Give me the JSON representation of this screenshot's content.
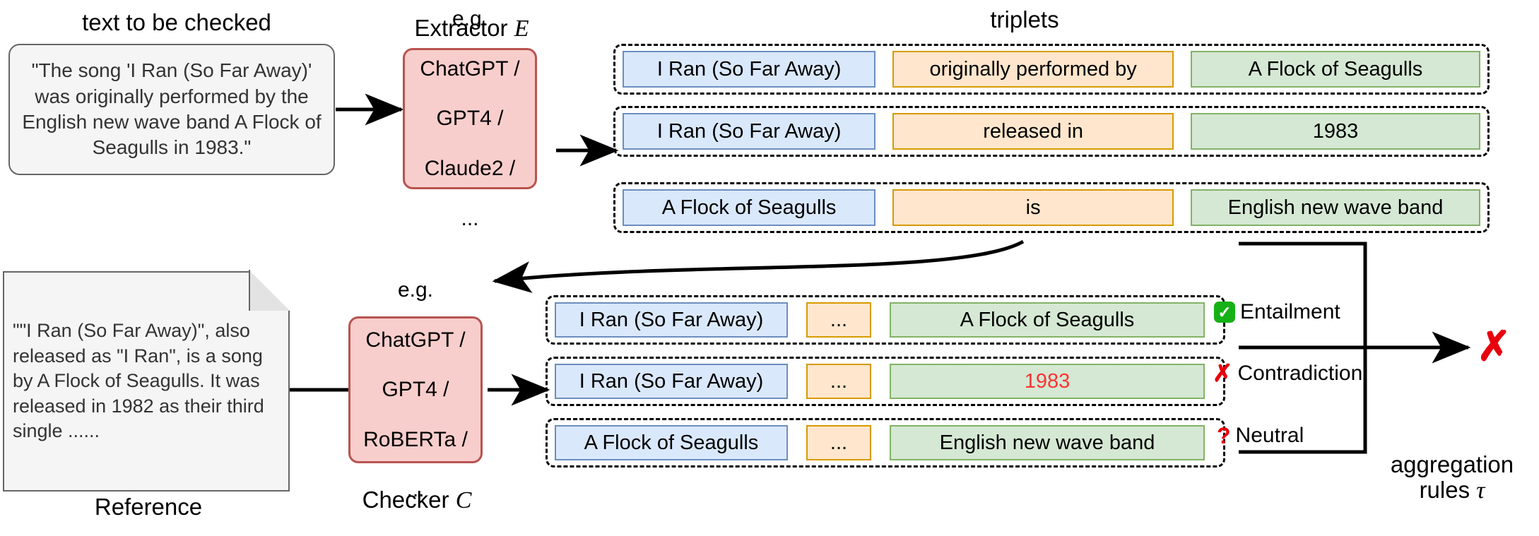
{
  "labels": {
    "text_to_be_checked": "text to be checked",
    "extractor": "Extractor",
    "extractor_symbol": "E",
    "triplets": "triplets",
    "reference": "Reference",
    "checker": "Checker",
    "checker_symbol": "C",
    "aggregation_line1": "aggregation",
    "aggregation_line2": "rules",
    "aggregation_symbol": "τ"
  },
  "input_text": "\"The song 'I Ran (So Far Away)' was originally performed by the English new wave band A Flock of Seagulls in 1983.\"",
  "reference_text": "\"\"I Ran (So Far Away)\", also released as \"I Ran\", is a song by A Flock of Seagulls. It was released in 1982 as their third single ......",
  "extractor_models": [
    "e.g.",
    "ChatGPT /",
    "GPT4 /",
    "Claude2 /",
    "..."
  ],
  "checker_models": [
    "e.g.",
    "ChatGPT /",
    "GPT4 /",
    "RoBERTa /",
    "..."
  ],
  "triplets_extracted": [
    {
      "subject": "I Ran (So Far Away)",
      "relation": "originally performed by",
      "object": "A Flock of Seagulls"
    },
    {
      "subject": "I Ran (So Far Away)",
      "relation": "released in",
      "object": "1983"
    },
    {
      "subject": "A Flock of Seagulls",
      "relation": "is",
      "object": "English new wave band"
    }
  ],
  "triplets_checked": [
    {
      "subject": "I Ran (So Far Away)",
      "relation": "...",
      "object": "A Flock of Seagulls",
      "object_highlighted": false,
      "verdict": "Entailment",
      "verdict_icon": "check-badge-icon"
    },
    {
      "subject": "I Ran (So Far Away)",
      "relation": "...",
      "object": "1983",
      "object_highlighted": true,
      "verdict": "Contradiction",
      "verdict_icon": "cross-mark-icon"
    },
    {
      "subject": "A Flock of Seagulls",
      "relation": "...",
      "object": "English new wave band",
      "object_highlighted": false,
      "verdict": "Neutral",
      "verdict_icon": "question-mark-icon"
    }
  ],
  "final_verdict_icon": "red-cross-icon",
  "colors": {
    "subject_fill": "#dae8fc",
    "subject_border": "#6c8ebf",
    "relation_fill": "#ffe6cc",
    "relation_border": "#d79b00",
    "object_fill": "#d5e8d4",
    "object_border": "#82b366",
    "model_fill": "#f8cecc",
    "model_border": "#b85450",
    "doc_fill": "#f5f5f5",
    "doc_border": "#666666",
    "entail_green": "#16b116",
    "contradiction_red": "#e8000d",
    "highlight_red": "#ff3333"
  }
}
